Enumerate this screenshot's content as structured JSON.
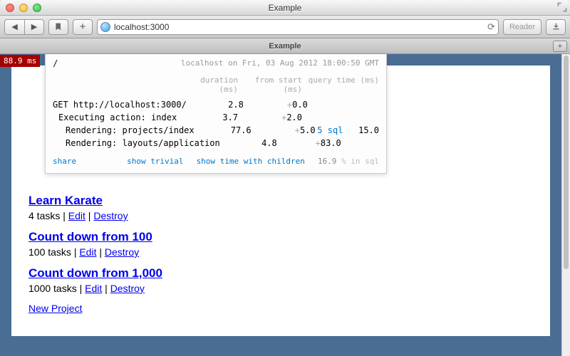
{
  "window": {
    "title": "Example"
  },
  "browser": {
    "url": "localhost:3000",
    "tab_title": "Example",
    "reader_label": "Reader"
  },
  "badge": {
    "time": "88.9 ms"
  },
  "profiler": {
    "path": "/",
    "timestamp": "localhost on Fri, 03 Aug 2012 18:00:50 GMT",
    "columns": {
      "dur": "duration (ms)",
      "from": "from start (ms)",
      "qt": "query time (ms)"
    },
    "rows": [
      {
        "label": "GET http://localhost:3000/",
        "indent": 0,
        "dur": "2.8",
        "from": "0.0",
        "sql": "",
        "qt": ""
      },
      {
        "label": "Executing action: index",
        "indent": 1,
        "dur": "3.7",
        "from": "2.0",
        "sql": "",
        "qt": ""
      },
      {
        "label": "Rendering: projects/index",
        "indent": 2,
        "dur": "77.6",
        "from": "5.0",
        "sql": "5 sql",
        "qt": "15.0"
      },
      {
        "label": "Rendering: layouts/application",
        "indent": 2,
        "dur": "4.8",
        "from": "83.0",
        "sql": "",
        "qt": ""
      }
    ],
    "footer": {
      "share": "share",
      "trivial": "show trivial",
      "children": "show time with children",
      "pct": "16.9",
      "pct_suffix": "% in sql"
    }
  },
  "page": {
    "projects": [
      {
        "title": "Learn Karate",
        "tasks": "4 tasks",
        "edit": "Edit",
        "destroy": "Destroy"
      },
      {
        "title": "Count down from 100",
        "tasks": "100 tasks",
        "edit": "Edit",
        "destroy": "Destroy"
      },
      {
        "title": "Count down from 1,000",
        "tasks": "1000 tasks",
        "edit": "Edit",
        "destroy": "Destroy"
      }
    ],
    "new_project": "New Project",
    "sep": " | "
  }
}
